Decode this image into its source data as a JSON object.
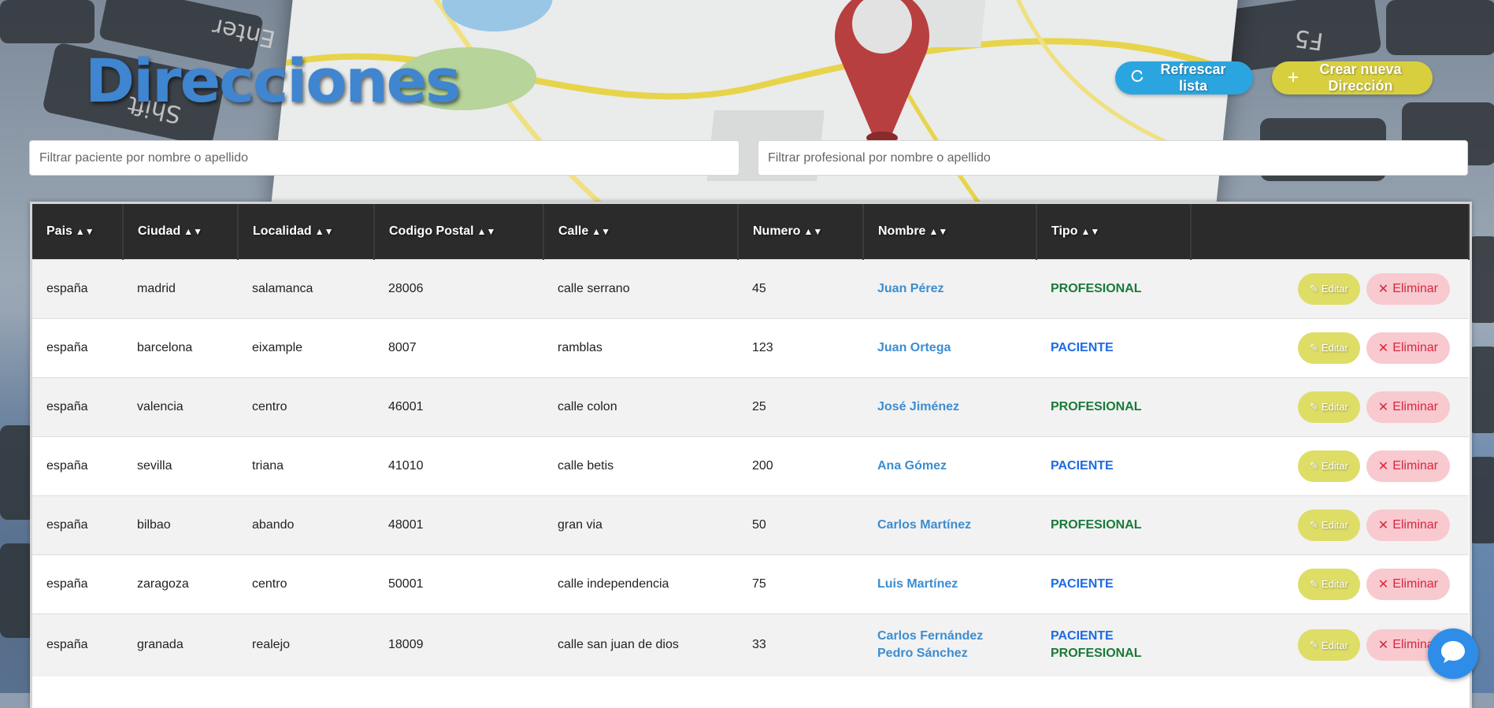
{
  "page": {
    "title": "Direcciones"
  },
  "toolbar": {
    "refresh_label": "Refrescar lista",
    "refresh_icon": "refresh-icon",
    "create_label": "Crear nueva Dirección",
    "create_icon": "plus-icon"
  },
  "filters": {
    "patient_placeholder": "Filtrar paciente por nombre o apellido",
    "patient_value": "",
    "professional_placeholder": "Filtrar profesional por nombre o apellido",
    "professional_value": ""
  },
  "table": {
    "columns": [
      "Pais",
      "Ciudad",
      "Localidad",
      "Codigo Postal",
      "Calle",
      "Numero",
      "Nombre",
      "Tipo"
    ],
    "sort_icon": "sort-icon",
    "edit_label": "Editar",
    "delete_label": "Eliminar",
    "rows": [
      {
        "pais": "españa",
        "ciudad": "madrid",
        "localidad": "salamanca",
        "cp": "28006",
        "calle": "calle serrano",
        "numero": "45",
        "nombre": [
          "Juan Pérez"
        ],
        "tipo": [
          "PROFESIONAL"
        ]
      },
      {
        "pais": "españa",
        "ciudad": "barcelona",
        "localidad": "eixample",
        "cp": "8007",
        "calle": "ramblas",
        "numero": "123",
        "nombre": [
          "Juan Ortega"
        ],
        "tipo": [
          "PACIENTE"
        ]
      },
      {
        "pais": "españa",
        "ciudad": "valencia",
        "localidad": "centro",
        "cp": "46001",
        "calle": "calle colon",
        "numero": "25",
        "nombre": [
          "José Jiménez"
        ],
        "tipo": [
          "PROFESIONAL"
        ]
      },
      {
        "pais": "españa",
        "ciudad": "sevilla",
        "localidad": "triana",
        "cp": "41010",
        "calle": "calle betis",
        "numero": "200",
        "nombre": [
          "Ana Gómez"
        ],
        "tipo": [
          "PACIENTE"
        ]
      },
      {
        "pais": "españa",
        "ciudad": "bilbao",
        "localidad": "abando",
        "cp": "48001",
        "calle": "gran via",
        "numero": "50",
        "nombre": [
          "Carlos Martínez"
        ],
        "tipo": [
          "PROFESIONAL"
        ]
      },
      {
        "pais": "españa",
        "ciudad": "zaragoza",
        "localidad": "centro",
        "cp": "50001",
        "calle": "calle independencia",
        "numero": "75",
        "nombre": [
          "Luis Martínez"
        ],
        "tipo": [
          "PACIENTE"
        ]
      },
      {
        "pais": "españa",
        "ciudad": "granada",
        "localidad": "realejo",
        "cp": "18009",
        "calle": "calle san juan de dios",
        "numero": "33",
        "nombre": [
          "Carlos Fernández",
          "Pedro Sánchez"
        ],
        "tipo": [
          "PACIENTE",
          "PROFESIONAL"
        ]
      }
    ]
  },
  "chat": {
    "icon": "chat-bubble-icon"
  },
  "colors": {
    "title": "#3f85d0",
    "refresh_button": "#2ba5e0",
    "create_button": "#d8cf3f",
    "header_bg": "#2b2b2b",
    "name_link": "#3c8dd1",
    "profesional": "#1a7a3a",
    "paciente": "#1e6be3",
    "edit_button": "#dedd66",
    "delete_button": "#f8c9cf",
    "delete_text": "#d9263f",
    "chat": "#2e8de8"
  }
}
